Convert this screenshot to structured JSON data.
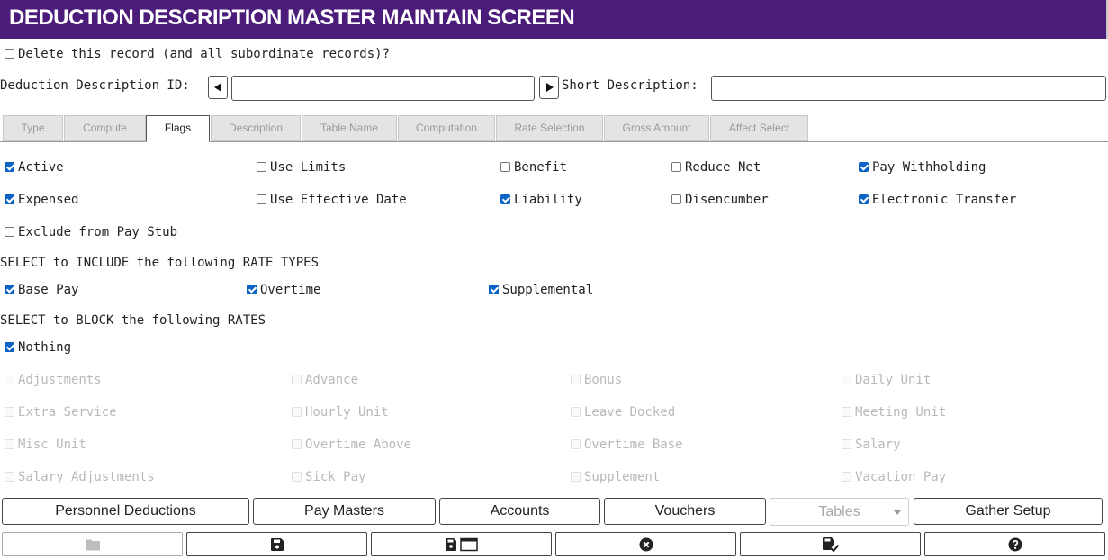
{
  "header": {
    "title": "DEDUCTION DESCRIPTION MASTER MAINTAIN SCREEN"
  },
  "delete_record": {
    "label": "Delete this record (and all subordinate records)?",
    "checked": false
  },
  "id_field": {
    "label": "Deduction Description ID:",
    "value": ""
  },
  "short_desc": {
    "label": "Short Description:",
    "value": ""
  },
  "tabs": [
    {
      "label": "Type"
    },
    {
      "label": "Compute"
    },
    {
      "label": "Flags"
    },
    {
      "label": "Description"
    },
    {
      "label": "Table Name"
    },
    {
      "label": "Computation"
    },
    {
      "label": "Rate Selection"
    },
    {
      "label": "Gross Amount"
    },
    {
      "label": "Affect Select"
    }
  ],
  "active_tab": "Flags",
  "flags": {
    "active": {
      "label": "Active",
      "checked": true
    },
    "use_limits": {
      "label": "Use Limits",
      "checked": false
    },
    "benefit": {
      "label": "Benefit",
      "checked": false
    },
    "reduce_net": {
      "label": "Reduce Net",
      "checked": false
    },
    "pay_withholding": {
      "label": "Pay Withholding",
      "checked": true
    },
    "expensed": {
      "label": "Expensed",
      "checked": true
    },
    "use_effective_date": {
      "label": "Use Effective Date",
      "checked": false
    },
    "liability": {
      "label": "Liability",
      "checked": true
    },
    "disencumber": {
      "label": "Disencumber",
      "checked": false
    },
    "electronic_transfer": {
      "label": "Electronic Transfer",
      "checked": true
    },
    "exclude_from_pay_stub": {
      "label": "Exclude from Pay Stub",
      "checked": false
    }
  },
  "include_heading": "SELECT to INCLUDE the following RATE TYPES",
  "include": {
    "base_pay": {
      "label": "Base Pay",
      "checked": true
    },
    "overtime": {
      "label": "Overtime",
      "checked": true
    },
    "supplemental": {
      "label": "Supplemental",
      "checked": true
    }
  },
  "block_heading": "SELECT to BLOCK the following RATES",
  "block": {
    "nothing": {
      "label": "Nothing",
      "checked": true
    },
    "rates": [
      "Adjustments",
      "Advance",
      "Bonus",
      "Daily Unit",
      "Extra Service",
      "Hourly Unit",
      "Leave Docked",
      "Meeting Unit",
      "Misc Unit",
      "Overtime Above",
      "Overtime Base",
      "Salary",
      "Salary Adjustments",
      "Sick Pay",
      "Supplement",
      "Vacation Pay"
    ]
  },
  "buttons": {
    "personnel_deductions": "Personnel Deductions",
    "pay_masters": "Pay Masters",
    "accounts": "Accounts",
    "vouchers": "Vouchers",
    "tables_select": "Tables",
    "gather_setup": "Gather Setup"
  },
  "toolbar_icons": [
    "folder-icon",
    "save-icon",
    "save-and-new-icon",
    "cancel-icon",
    "save-and-close-icon",
    "help-icon"
  ]
}
